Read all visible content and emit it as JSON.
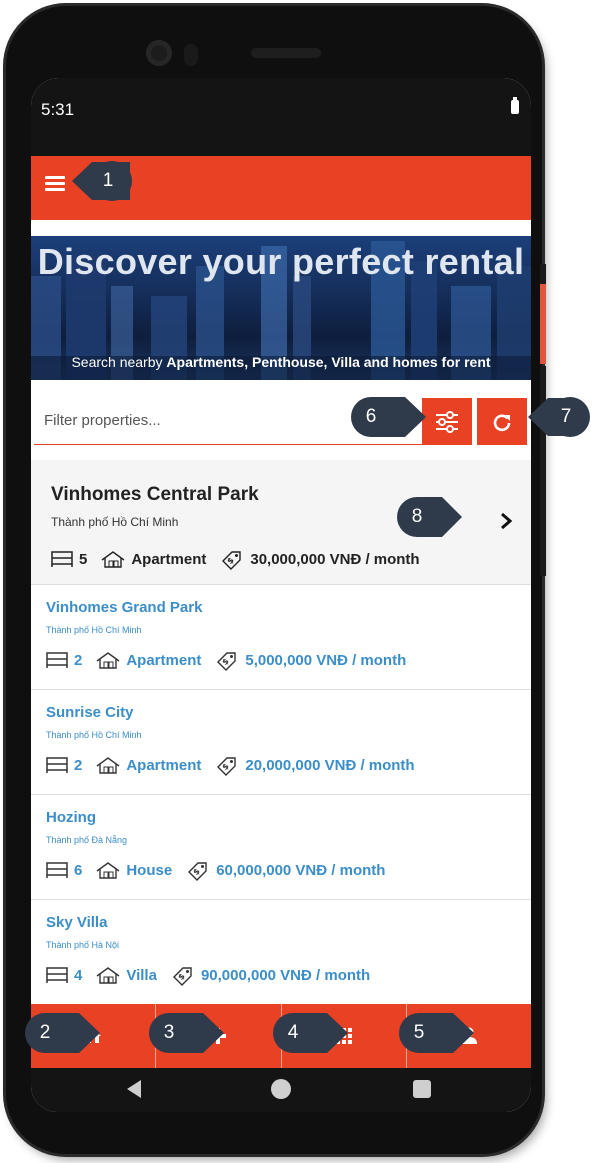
{
  "status_bar": {
    "time": "5:31"
  },
  "hero": {
    "title": "Discover your perfect rental",
    "subtitle_prefix": "Search nearby ",
    "subtitle_bold": "Apartments, Penthouse, Villa and homes for rent"
  },
  "filter": {
    "placeholder": "Filter properties..."
  },
  "featured": {
    "title": "Vinhomes Central Park",
    "city": "Thành phố Hồ Chí Minh",
    "bedrooms": "5",
    "type": "Apartment",
    "price": "30,000,000 VNĐ / month"
  },
  "listings": [
    {
      "title": "Vinhomes Grand Park",
      "city": "Thành phố Hồ Chí Minh",
      "bedrooms": "2",
      "type": "Apartment",
      "price": "5,000,000 VNĐ / month"
    },
    {
      "title": "Sunrise City",
      "city": "Thành phố Hồ Chí Minh",
      "bedrooms": "2",
      "type": "Apartment",
      "price": "20,000,000 VNĐ / month"
    },
    {
      "title": "Hozing",
      "city": "Thành phố Đà Nẵng",
      "bedrooms": "6",
      "type": "House",
      "price": "60,000,000 VNĐ / month"
    },
    {
      "title": "Sky Villa",
      "city": "Thành phố Hà Nội",
      "bedrooms": "4",
      "type": "Villa",
      "price": "90,000,000 VNĐ / month"
    }
  ],
  "tabs": [
    {
      "icon": "home-icon"
    },
    {
      "icon": "plus-icon"
    },
    {
      "icon": "grid-icon"
    },
    {
      "icon": "user-icon"
    }
  ],
  "callouts": [
    "1",
    "2",
    "3",
    "4",
    "5",
    "6",
    "7",
    "8"
  ],
  "colors": {
    "accent": "#e84124",
    "link": "#3b8ec9",
    "callout": "#2f3a4a"
  }
}
